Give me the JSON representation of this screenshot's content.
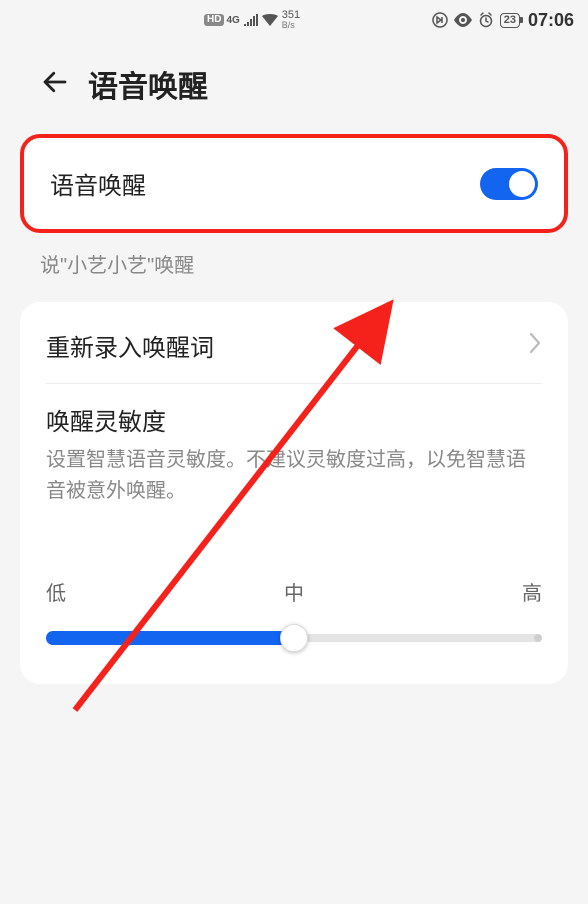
{
  "status": {
    "hd_label": "HD",
    "net_label": "4G",
    "speed_number": "351",
    "speed_unit": "B/s",
    "battery_text": "23",
    "clock": "07:06"
  },
  "header": {
    "title": "语音唤醒"
  },
  "toggle": {
    "label": "语音唤醒",
    "on": true
  },
  "hint": "说\"小艺小艺\"唤醒",
  "rerecord": {
    "label": "重新录入唤醒词"
  },
  "sensitivity": {
    "title": "唤醒灵敏度",
    "description": "设置智慧语音灵敏度。不建议灵敏度过高，以免智慧语音被意外唤醒。",
    "levels": {
      "low": "低",
      "mid": "中",
      "high": "高"
    },
    "value_fraction": 0.5
  },
  "annotation": {
    "highlight_color": "#f5221c",
    "arrow_color": "#f5221c"
  }
}
